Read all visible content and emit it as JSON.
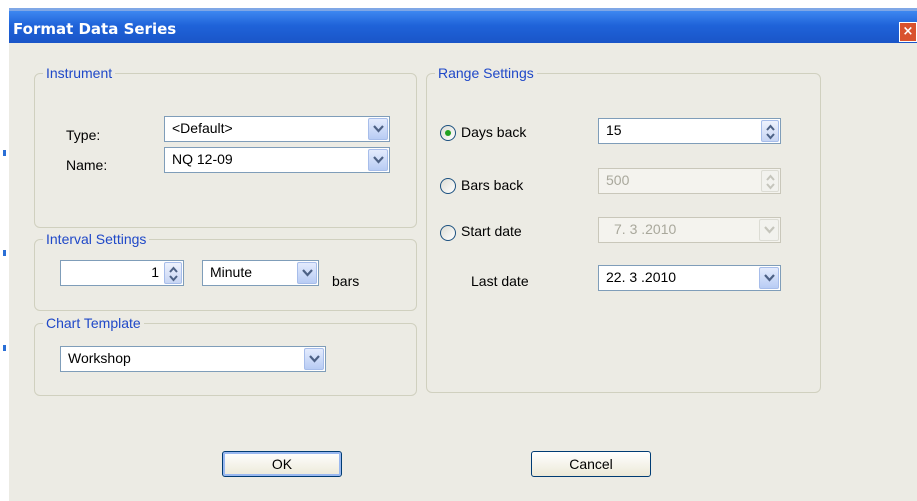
{
  "dialog": {
    "title": "Format Data Series",
    "close_glyph": "×"
  },
  "instrument": {
    "legend": "Instrument",
    "type_label": "Type:",
    "type_value": "<Default>",
    "name_label": "Name:",
    "name_value": "NQ 12-09"
  },
  "interval": {
    "legend": "Interval Settings",
    "value": "1",
    "unit": "Minute",
    "suffix": "bars"
  },
  "chart_template": {
    "legend": "Chart Template",
    "value": "Workshop"
  },
  "range": {
    "legend": "Range Settings",
    "days_back_label": "Days back",
    "days_back_value": "15",
    "bars_back_label": "Bars back",
    "bars_back_value": "500",
    "start_date_label": "Start date",
    "start_date_value": "7. 3 .2010",
    "last_date_label": "Last date",
    "last_date_value": "22. 3 .2010",
    "selected": "Days back"
  },
  "buttons": {
    "ok": "OK",
    "cancel": "Cancel"
  },
  "icons": {
    "dropdown": "chevron-down-icon",
    "spinner": "spin-arrows-icon",
    "close": "close-icon"
  },
  "colors": {
    "titlebar": "#1f63d9",
    "legend_text": "#1f48c8",
    "radio_selected": "#21a121"
  }
}
